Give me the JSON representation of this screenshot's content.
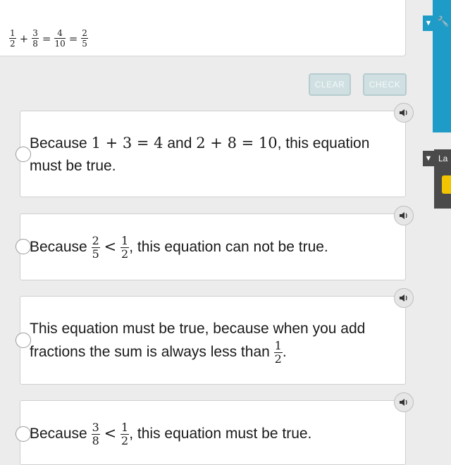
{
  "question": {
    "equation": [
      {
        "num": "1",
        "den": "2"
      },
      {
        "op": "+"
      },
      {
        "num": "3",
        "den": "8"
      },
      {
        "op": "="
      },
      {
        "num": "4",
        "den": "10"
      },
      {
        "op": "="
      },
      {
        "num": "2",
        "den": "5"
      }
    ]
  },
  "buttons": {
    "clear": "CLEAR",
    "check": "CHECK"
  },
  "options": [
    {
      "pre": "Because ",
      "math": "1 + 3 = 4",
      "mid": " and ",
      "math2": "2 + 8 = 10",
      "post": ", this equation must be true."
    },
    {
      "pre": "Because ",
      "f1": {
        "num": "2",
        "den": "5"
      },
      "rel": "<",
      "f2": {
        "num": "1",
        "den": "2"
      },
      "post": ", this equation can not be true."
    },
    {
      "line1": "This equation must be true, because when you add",
      "line2": "fractions the sum is always less than ",
      "f": {
        "num": "1",
        "den": "2"
      },
      "post": "."
    },
    {
      "pre": "Because ",
      "f1": {
        "num": "3",
        "den": "8"
      },
      "rel": "<",
      "f2": {
        "num": "1",
        "den": "2"
      },
      "post": ", this equation must be true."
    }
  ],
  "side_tools": {
    "lang_label": "La",
    "arrow": "▼",
    "wrench": "🔧"
  },
  "colors": {
    "accent": "#1e9bc6",
    "button_bg": "#cfdfe2",
    "lang_swatch": "#f2c500"
  },
  "icons": {
    "audio": "speaker-icon",
    "radio": "radio-circle",
    "tools": "wrench-icon"
  }
}
